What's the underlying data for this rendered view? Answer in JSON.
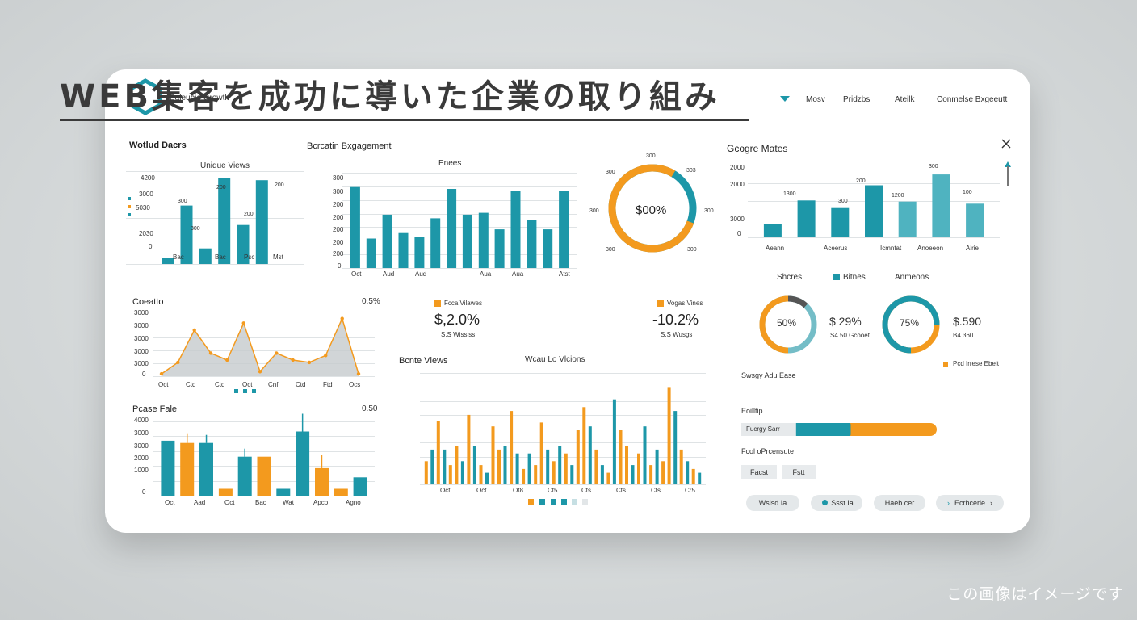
{
  "hero_title": "WEB集客を成功に導いた企業の取り組み",
  "footer_note": "この画像はイメージです",
  "brand": "Ealeubie Growth",
  "nav": [
    "Mosv",
    "Pridzbs",
    "Ateilk",
    "Conmelse Bxgeeutt"
  ],
  "colors": {
    "teal": "#1d97a8",
    "orange": "#f39a1e",
    "grid": "#dfe3e5"
  },
  "panel1": {
    "title": "Wotlud Dacrs",
    "subtitle": "Unique Views",
    "chart_data": {
      "type": "bar",
      "categories": [
        "Bac",
        "Bac",
        "Psc",
        "Mst"
      ],
      "values": [
        300,
        3000,
        800,
        4400,
        2000,
        4300
      ],
      "ytick_labels": [
        "4200",
        "3000",
        "5030",
        "2030",
        "0"
      ],
      "data_labels": [
        "300",
        "300",
        "200",
        "200",
        "200"
      ]
    }
  },
  "panel2": {
    "title": "Bcrcatin Bxgagement",
    "subtitle": "Enees",
    "chart_data": {
      "type": "bar",
      "categories": [
        "Oct",
        "Aud",
        "Aud",
        "Aua",
        "Aua",
        "Atst"
      ],
      "values": [
        88,
        32,
        58,
        38,
        34,
        54,
        86,
        58,
        60,
        42,
        84,
        52,
        42,
        84
      ],
      "ytick_labels": [
        "300",
        "300",
        "200",
        "200",
        "200",
        "200",
        "200",
        "0"
      ]
    }
  },
  "donut1": {
    "center": "$00%",
    "value": 0.78,
    "labels": [
      "300",
      "300",
      "303",
      "300",
      "300",
      "300",
      "300"
    ]
  },
  "panel3": {
    "title": "Gcogre Mates",
    "chart_data": {
      "type": "bar",
      "categories": [
        "Aeann",
        "Aceerus",
        "Icmntat",
        "Anoeeon",
        "Alrie"
      ],
      "values": [
        12,
        34,
        27,
        48,
        33,
        58,
        31
      ],
      "ytick_labels": [
        "2000",
        "2000",
        "3000",
        "0"
      ],
      "data_labels": [
        "1300",
        "300",
        "200",
        "1200",
        "300",
        "100"
      ]
    }
  },
  "legend_row": {
    "a": "Shcres",
    "b": "Bitnes",
    "c": "Anmeons"
  },
  "ring1": {
    "pct": "50%",
    "value": 0.5,
    "amount": "$ 29%",
    "note": "S4 50 Gcooet"
  },
  "ring2": {
    "pct": "75%",
    "value": 0.75,
    "amount": "$.590",
    "note": "B4 360"
  },
  "status_legend": "Pcd Irrese Ebeit",
  "side_labels": {
    "a": "Swsgy Adu Ease",
    "b": "Eoilltip",
    "c": "Fcol oPrcensute"
  },
  "progress": {
    "label": "Fucrgy Sarr",
    "value": 0.56
  },
  "pills": [
    "Facst",
    "Fstt"
  ],
  "buttons": [
    "Wsisd Ia",
    "Ssst Ia",
    "Haeb cer",
    "Ecrhcerle"
  ],
  "area_chart": {
    "title": "Coeatto",
    "value": "0.5%",
    "chart_data": {
      "type": "area",
      "categories": [
        "Oct",
        "Ctd",
        "Ctd",
        "Oct",
        "Cnf",
        "Ctd",
        "Ftd",
        "Ocs",
        "Ot5"
      ],
      "values": [
        2,
        12,
        40,
        20,
        14,
        46,
        4,
        20,
        14,
        12,
        18,
        50,
        2
      ],
      "ytick_labels": [
        "3000",
        "3000",
        "3000",
        "3000",
        "3000",
        "0"
      ]
    }
  },
  "metric1": {
    "legend": "Fcca Vilawes",
    "value": "$,2.0%",
    "note": "S.S Wusgs"
  },
  "metric2": {
    "legend": "Vogas Vines",
    "value": "-10.2%",
    "note": "S.S Wississ"
  },
  "bottom_left": {
    "title": "Pcase Fale",
    "value": "0.50",
    "chart_data": {
      "type": "bar",
      "categories": [
        "Oct",
        "Aad",
        "Oct",
        "Bac",
        "Wat",
        "Apco",
        "Agno"
      ],
      "values": [
        48,
        46,
        46,
        6,
        34,
        34,
        6,
        56,
        24,
        6,
        16
      ],
      "ytick_labels": [
        "4000",
        "3000",
        "3000",
        "2000",
        "1000",
        "0"
      ]
    }
  },
  "bottom_mid": {
    "title": "Bcnte Vlews",
    "subtitle": "Wcau Lo Vlcions",
    "chart_data": {
      "type": "bar",
      "categories": [
        "Oct",
        "Oct",
        "Ot8",
        "Ct5",
        "Cts",
        "Cts",
        "Cts",
        "Cr5"
      ],
      "values": [
        12,
        18,
        33,
        18,
        10,
        20,
        12,
        36,
        20,
        10,
        6,
        30,
        18,
        20,
        38,
        16,
        8,
        16,
        10,
        32,
        18,
        12,
        20,
        16,
        10,
        28,
        40,
        30,
        18,
        10,
        6,
        44,
        28,
        20,
        10,
        16,
        30,
        10,
        18,
        12,
        50,
        38,
        18,
        12,
        8,
        6
      ]
    }
  }
}
